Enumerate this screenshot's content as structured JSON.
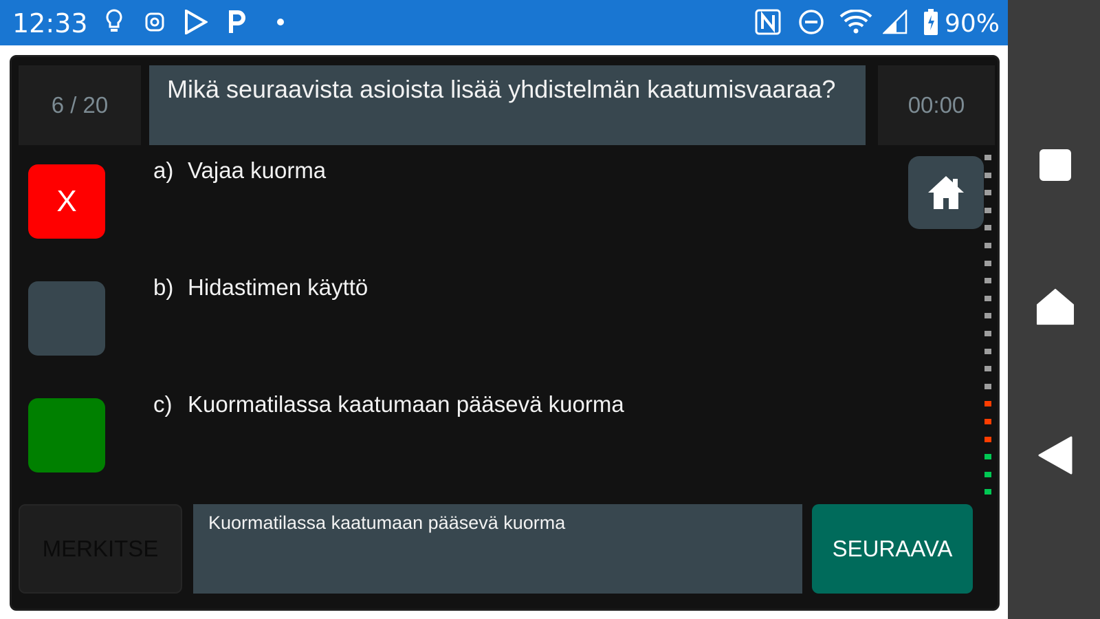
{
  "status_bar": {
    "time": "12:33",
    "battery": "90%",
    "icons": [
      "lightbulb-icon",
      "instagram-icon",
      "play-store-icon",
      "parking-icon",
      "dot-icon",
      "nfc-icon",
      "do-not-disturb-icon",
      "wifi-icon",
      "cell-signal-icon",
      "battery-icon"
    ]
  },
  "quiz": {
    "counter": "6 / 20",
    "question": "Mikä seuraavista asioista lisää yhdistelmän kaatumisvaaraa?",
    "timer": "00:00",
    "answers": [
      {
        "letter": "a)",
        "text": "Vajaa kuorma",
        "state": "wrong",
        "mark": "X"
      },
      {
        "letter": "b)",
        "text": "Hidastimen käyttö",
        "state": "neutral",
        "mark": ""
      },
      {
        "letter": "c)",
        "text": "Kuormatilassa kaatumaan pääsevä kuorma",
        "state": "correct",
        "mark": ""
      }
    ],
    "mark_label": "MERKITSE",
    "selected_answer": "Kuormatilassa kaatumaan pääsevä kuorma",
    "next_label": "SEURAAVA",
    "progress": [
      "#9e9e9e",
      "#9e9e9e",
      "#9e9e9e",
      "#9e9e9e",
      "#9e9e9e",
      "#9e9e9e",
      "#9e9e9e",
      "#9e9e9e",
      "#9e9e9e",
      "#9e9e9e",
      "#9e9e9e",
      "#9e9e9e",
      "#9e9e9e",
      "#9e9e9e",
      "#ff3d00",
      "#ff3d00",
      "#ff3d00",
      "#00c853",
      "#00c853",
      "#00c853"
    ]
  },
  "colors": {
    "status_bar": "#1976d2",
    "wrong": "#ff0000",
    "correct": "#008000",
    "panel": "#38474f",
    "next": "#006b5b"
  }
}
